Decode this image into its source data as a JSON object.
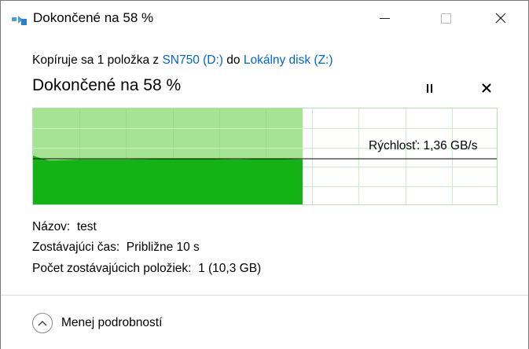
{
  "window": {
    "title": "Dokončené na 58 %",
    "icon": "copy-files-icon",
    "controls": [
      "minimize-icon",
      "maximize-icon",
      "close-icon"
    ]
  },
  "copy_info": {
    "prefix": "Kopíruje sa 1 položka z ",
    "source": "SN750 (D:)",
    "middle": " do ",
    "destination": "Lokálny disk (Z:)"
  },
  "progress": {
    "heading": "Dokončené na 58 %",
    "percent": 58,
    "speed_label": "Rýchlosť: 1,36 GB/s"
  },
  "colors": {
    "progress_fill": "#a6e392",
    "speed_area": "#14b214",
    "link": "#0066cc"
  },
  "details": {
    "name_label": "Názov:",
    "name_value": "test",
    "time_label": "Zostávajúci čas:",
    "time_value": "Približne 10 s",
    "count_label": "Počet zostávajúcich položiek:",
    "count_value": "1 (10,3 GB)"
  },
  "footer": {
    "toggle_label": "Menej podrobností",
    "toggle_icon": "chevron-up-icon"
  }
}
